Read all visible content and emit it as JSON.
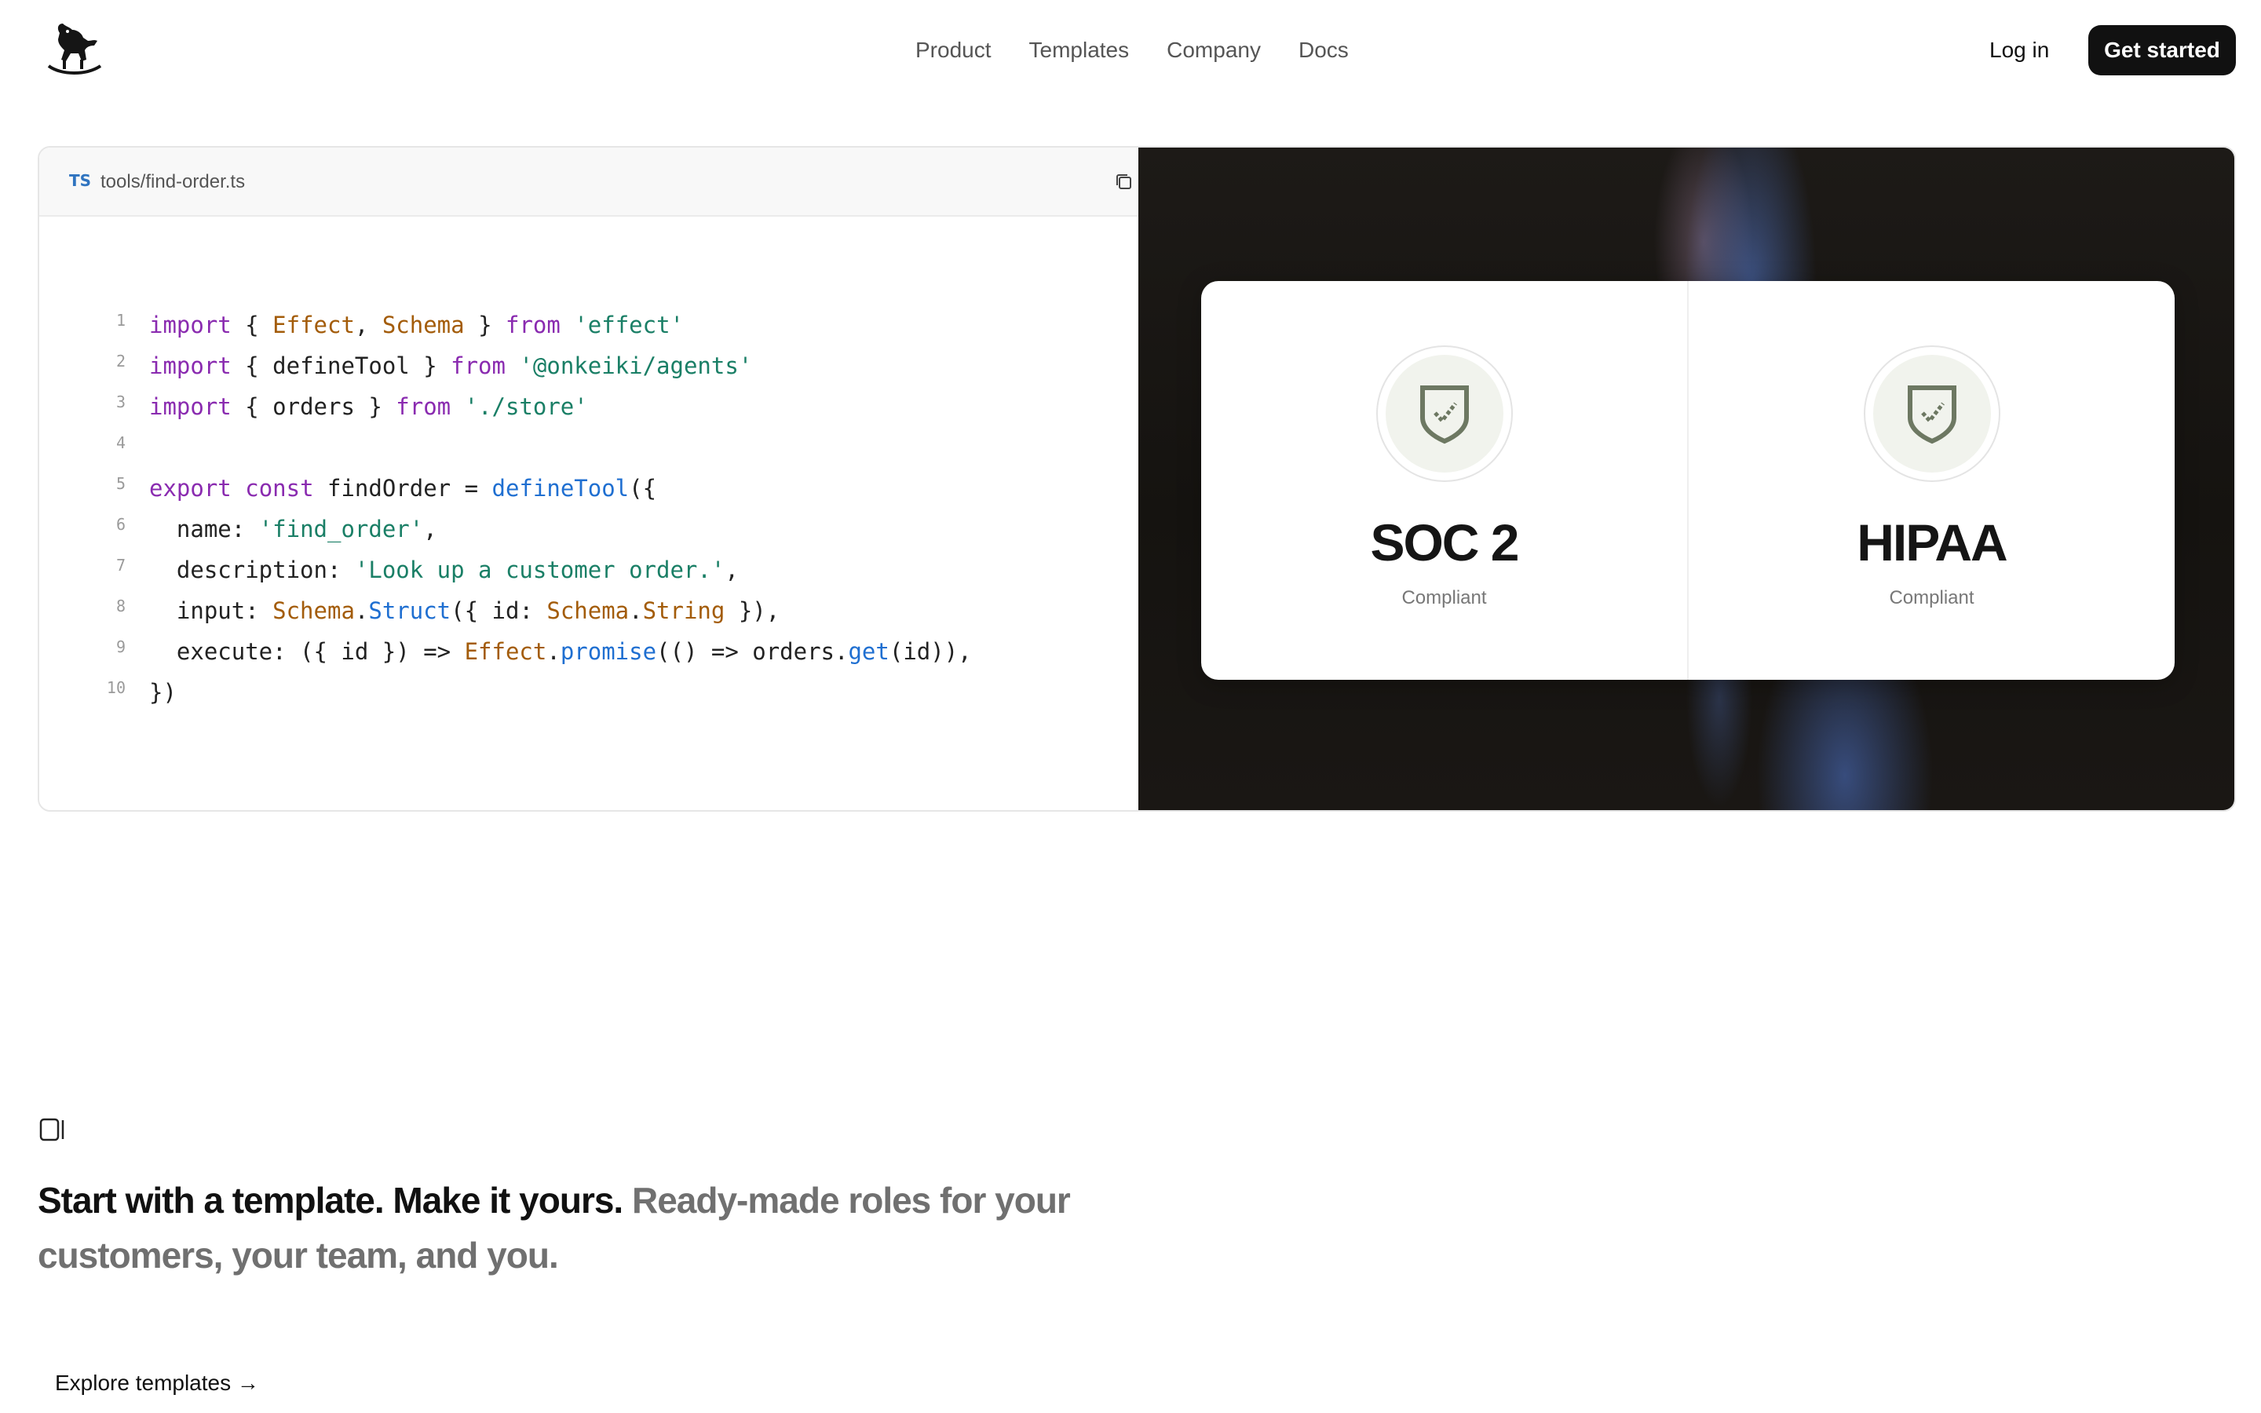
{
  "nav": {
    "logo_icon": "rocking-horse-logo",
    "links": [
      "Product",
      "Templates",
      "Company",
      "Docs"
    ],
    "login": "Log in",
    "cta": "Get started"
  },
  "code": {
    "lang_badge": "TS",
    "filename": "tools/find-order.ts",
    "copy_icon": "copy-icon",
    "line_numbers": [
      "1",
      "2",
      "3",
      "4",
      "5",
      "6",
      "7",
      "8",
      "9",
      "10"
    ],
    "lines": [
      [
        [
          "k",
          "import"
        ],
        [
          "p",
          " { "
        ],
        [
          "t",
          "Effect"
        ],
        [
          "p",
          ", "
        ],
        [
          "t",
          "Schema"
        ],
        [
          "p",
          " } "
        ],
        [
          "k",
          "from"
        ],
        [
          "p",
          " "
        ],
        [
          "s",
          "'effect'"
        ]
      ],
      [
        [
          "k",
          "import"
        ],
        [
          "p",
          " { defineTool } "
        ],
        [
          "k",
          "from"
        ],
        [
          "p",
          " "
        ],
        [
          "s",
          "'@onkeiki/agents'"
        ]
      ],
      [
        [
          "k",
          "import"
        ],
        [
          "p",
          " { orders } "
        ],
        [
          "k",
          "from"
        ],
        [
          "p",
          " "
        ],
        [
          "s",
          "'./store'"
        ]
      ],
      [],
      [
        [
          "k",
          "export"
        ],
        [
          "p",
          " "
        ],
        [
          "k",
          "const"
        ],
        [
          "p",
          " findOrder = "
        ],
        [
          "f",
          "defineTool"
        ],
        [
          "p",
          "({"
        ]
      ],
      [
        [
          "p",
          "  name: "
        ],
        [
          "s",
          "'find_order'"
        ],
        [
          "p",
          ","
        ]
      ],
      [
        [
          "p",
          "  description: "
        ],
        [
          "s",
          "'Look up a customer order.'"
        ],
        [
          "p",
          ","
        ]
      ],
      [
        [
          "p",
          "  input: "
        ],
        [
          "t",
          "Schema"
        ],
        [
          "p",
          "."
        ],
        [
          "f",
          "Struct"
        ],
        [
          "p",
          "({ id: "
        ],
        [
          "t",
          "Schema"
        ],
        [
          "p",
          "."
        ],
        [
          "t",
          "String"
        ],
        [
          "p",
          " }),"
        ]
      ],
      [
        [
          "p",
          "  execute: ({ id }) => "
        ],
        [
          "t",
          "Effect"
        ],
        [
          "p",
          "."
        ],
        [
          "f",
          "promise"
        ],
        [
          "p",
          "(() => orders."
        ],
        [
          "f",
          "get"
        ],
        [
          "p",
          "(id)),"
        ]
      ],
      [
        [
          "p",
          "})"
        ]
      ]
    ]
  },
  "compliance": [
    {
      "title": "SOC 2",
      "subtitle": "Compliant",
      "icon": "shield-check-icon"
    },
    {
      "title": "HIPAA",
      "subtitle": "Compliant",
      "icon": "shield-check-icon"
    }
  ],
  "templates": {
    "icon": "panel-icon",
    "headline_strong": "Start with a template. Make it yours.",
    "headline_muted": " Ready-made roles for your customers, your team, and you.",
    "link": "Explore templates →"
  }
}
